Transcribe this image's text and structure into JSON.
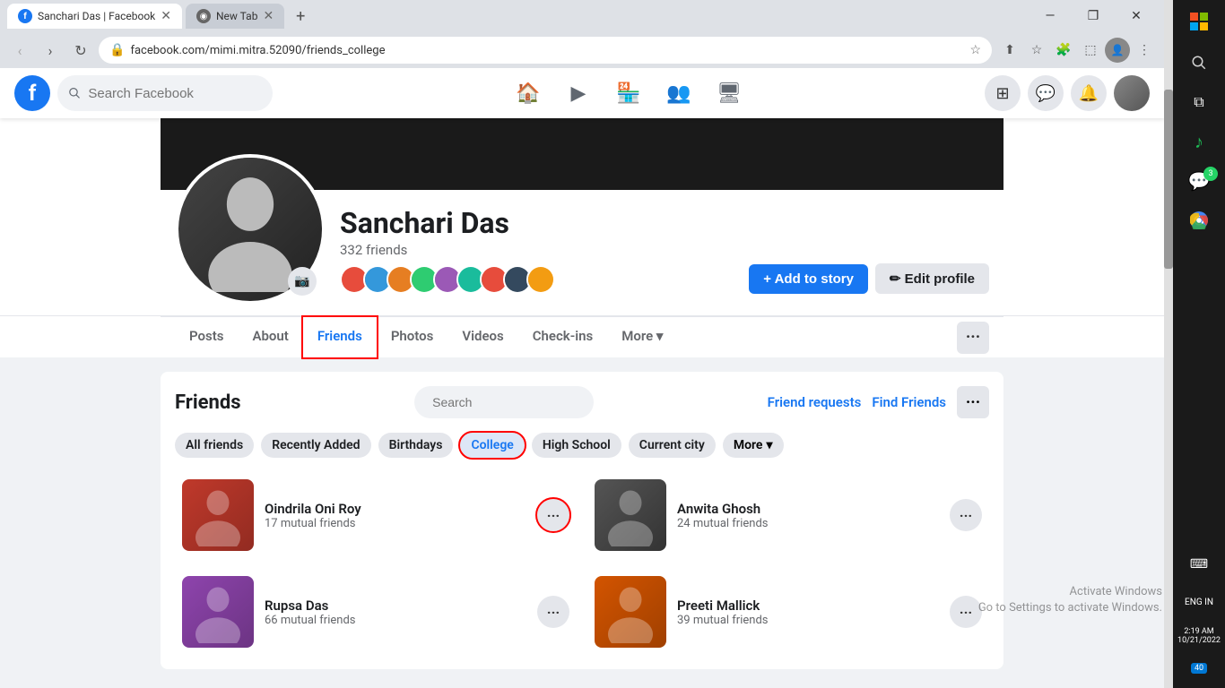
{
  "browser": {
    "tabs": [
      {
        "id": "tab1",
        "label": "Sanchari Das | Facebook",
        "favicon": "F",
        "favicon_bg": "#1877f2",
        "active": true
      },
      {
        "id": "tab2",
        "label": "New Tab",
        "favicon": "◉",
        "favicon_bg": "#666",
        "active": false
      }
    ],
    "url": "facebook.com/mimi.mitra.52090/friends_college",
    "window_controls": [
      "—",
      "❐",
      "✕"
    ]
  },
  "facebook": {
    "search_placeholder": "Search Facebook",
    "nav_icons": [
      "🏠",
      "▶",
      "🏪",
      "👥",
      "🖥"
    ],
    "action_icons": [
      "⊞",
      "💬",
      "🔔"
    ]
  },
  "profile": {
    "name": "Sanchari Das",
    "friends_count": "332 friends",
    "friend_avatars_count": 9,
    "friend_avatar_colors": [
      "#e74c3c",
      "#3498db",
      "#e67e22",
      "#2ecc71",
      "#9b59b6",
      "#1abc9c",
      "#e74c3c",
      "#34495e",
      "#f39c12"
    ],
    "tabs": [
      {
        "id": "posts",
        "label": "Posts",
        "active": false
      },
      {
        "id": "about",
        "label": "About",
        "active": false
      },
      {
        "id": "friends",
        "label": "Friends",
        "active": true,
        "highlighted": true
      },
      {
        "id": "photos",
        "label": "Photos",
        "active": false
      },
      {
        "id": "videos",
        "label": "Videos",
        "active": false
      },
      {
        "id": "checkins",
        "label": "Check-ins",
        "active": false
      },
      {
        "id": "more",
        "label": "More ▾",
        "active": false
      }
    ],
    "btn_add_story": "+ Add to story",
    "btn_edit_profile": "✏ Edit profile"
  },
  "friends_section": {
    "title": "Friends",
    "search_placeholder": "Search",
    "action_friend_requests": "Friend requests",
    "action_find_friends": "Find Friends",
    "subtabs": [
      {
        "id": "all",
        "label": "All friends"
      },
      {
        "id": "recently_added",
        "label": "Recently Added"
      },
      {
        "id": "birthdays",
        "label": "Birthdays"
      },
      {
        "id": "college",
        "label": "College",
        "active": true,
        "highlighted": true
      },
      {
        "id": "high_school",
        "label": "High School"
      },
      {
        "id": "current_city",
        "label": "Current city"
      },
      {
        "id": "more",
        "label": "More ▾"
      }
    ],
    "friends": [
      {
        "id": "f1",
        "name": "Oindrila Oni Roy",
        "mutual": "17 mutual friends",
        "color": "#c0392b",
        "highlighted_menu": true
      },
      {
        "id": "f2",
        "name": "Anwita Ghosh",
        "mutual": "24 mutual friends",
        "color": "#555"
      },
      {
        "id": "f3",
        "name": "Rupsa Das",
        "mutual": "66 mutual friends",
        "color": "#8e44ad"
      },
      {
        "id": "f4",
        "name": "Preeti Mallick",
        "mutual": "39 mutual friends",
        "color": "#d35400"
      }
    ]
  },
  "taskbar": {
    "items": [
      {
        "icon": "🔍",
        "label": ""
      },
      {
        "icon": "♪",
        "label": "",
        "color": "#1db954"
      },
      {
        "icon": "💬",
        "label": "",
        "badge": "3",
        "badge_color": "#25d366"
      },
      {
        "icon": "🌐",
        "label": "",
        "color": "#4285f4"
      }
    ],
    "bottom": {
      "lang": "ENG IN",
      "time": "2:19 AM",
      "date": "10/21/2022",
      "notification": "40"
    }
  },
  "activate_windows": {
    "line1": "Activate Windows",
    "line2": "Go to Settings to activate Windows."
  }
}
